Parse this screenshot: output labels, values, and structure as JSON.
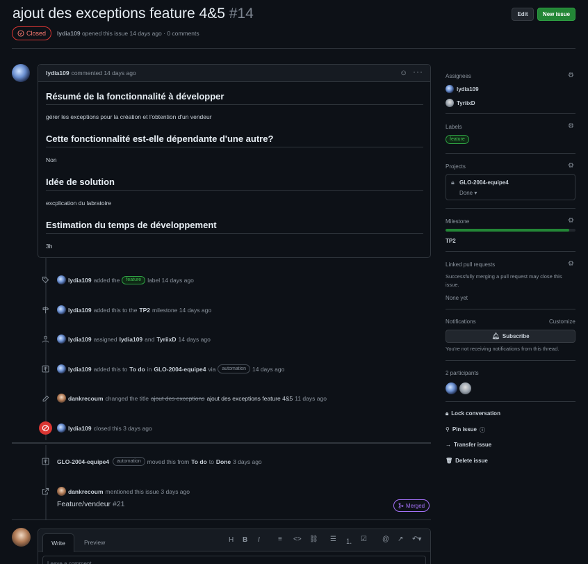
{
  "issue": {
    "title": "ajout des exceptions feature 4&5",
    "number": "#14",
    "state": "Closed",
    "meta_author": "lydia109",
    "meta_text": "opened this issue 14 days ago · 0 comments"
  },
  "header": {
    "edit_label": "Edit",
    "new_issue_label": "New issue"
  },
  "comment": {
    "author": "lydia109",
    "action": "commented 14 days ago",
    "sections": [
      {
        "heading": "Résumé de la fonctionnalité à développer",
        "body": "gérer les exceptions pour la création et l'obtention d'un vendeur"
      },
      {
        "heading": "Cette fonctionnalité est-elle dépendante d'une autre?",
        "body": "Non"
      },
      {
        "heading": "Idée de solution",
        "body": "excplication du labratoire"
      },
      {
        "heading": "Estimation du temps de développement",
        "body": "3h"
      }
    ]
  },
  "timeline": {
    "label_event": {
      "user": "lydia109",
      "before": "added the",
      "label": "feature",
      "after": "label 14 days ago"
    },
    "milestone_event": {
      "user": "lydia109",
      "before": "added this to the",
      "milestone": "TP2",
      "after": "milestone 14 days ago"
    },
    "assign_event": {
      "user": "lydia109",
      "before": "assigned",
      "a1": "lydia109",
      "and": "and",
      "a2": "TyriixD",
      "after": "14 days ago"
    },
    "project_event": {
      "user": "lydia109",
      "before": "added this to",
      "col": "To do",
      "in": "in",
      "project": "GLO-2004-equipe4",
      "via": "via",
      "badge": "automation",
      "after": "14 days ago"
    },
    "rename_event": {
      "user": "dankrecoum",
      "before": "changed the title",
      "old": "ajout des exceptions",
      "new": "ajout des exceptions feature 4&5",
      "after": "11 days ago"
    },
    "close_event": {
      "user": "lydia109",
      "after": "closed this 3 days ago"
    },
    "move_event": {
      "project": "GLO-2004-equipe4",
      "badge": "automation",
      "before": "moved this from",
      "from": "To do",
      "to_word": "to",
      "to": "Done",
      "after": "3 days ago"
    },
    "mention_event": {
      "user": "dankrecoum",
      "after": "mentioned this issue 3 days ago",
      "pr_title": "Feature/vendeur",
      "pr_num": "#21",
      "pr_state": "Merged"
    }
  },
  "editor": {
    "tab_write": "Write",
    "tab_preview": "Preview",
    "placeholder": "Leave a comment"
  },
  "sidebar": {
    "assignees_heading": "Assignees",
    "assignees": [
      "lydia109",
      "TyriixD"
    ],
    "labels_heading": "Labels",
    "label": "feature",
    "projects_heading": "Projects",
    "project_name": "GLO-2004-equipe4",
    "project_status": "Done",
    "milestone_heading": "Milestone",
    "milestone_progress": 0.95,
    "milestone_name": "TP2",
    "linked_heading": "Linked pull requests",
    "linked_desc": "Successfully merging a pull request may close this issue.",
    "linked_none": "None yet",
    "notifications_heading": "Notifications",
    "customize": "Customize",
    "subscribe": "Subscribe",
    "notif_desc": "You're not receiving notifications from this thread.",
    "participants": "2 participants",
    "lock": "Lock conversation",
    "pin": "Pin issue",
    "transfer": "Transfer issue",
    "delete": "Delete issue"
  },
  "colors": {
    "accent_green": "#238636",
    "closed_red": "#da3633",
    "merged_purple": "#a371f7"
  }
}
